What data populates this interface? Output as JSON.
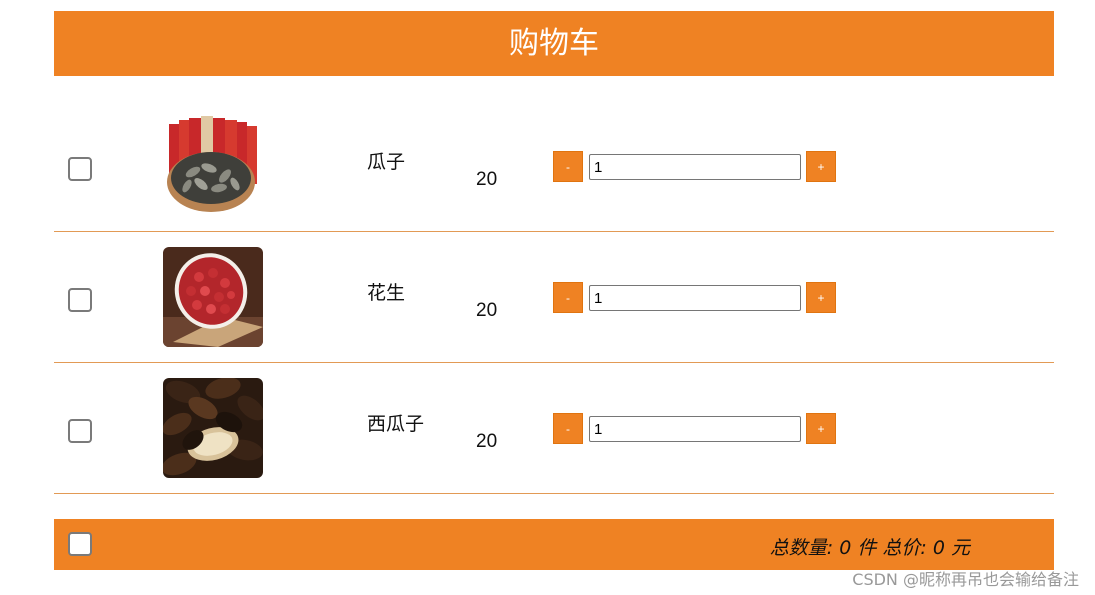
{
  "header": {
    "title": "购物车"
  },
  "items": [
    {
      "name": "瓜子",
      "price": "20",
      "quantity": "1",
      "minus_label": "-",
      "plus_label": "+",
      "image_icon": "sunflower-seeds-image"
    },
    {
      "name": "花生",
      "price": "20",
      "quantity": "1",
      "minus_label": "-",
      "plus_label": "+",
      "image_icon": "peanuts-image"
    },
    {
      "name": "西瓜子",
      "price": "20",
      "quantity": "1",
      "minus_label": "-",
      "plus_label": "+",
      "image_icon": "watermelon-seeds-image"
    }
  ],
  "footer": {
    "total_count_label": "总数量:",
    "total_count": "0",
    "count_unit": "件",
    "total_price_label": "总价:",
    "total_price": "0",
    "price_unit": "元"
  },
  "watermark": "CSDN @昵称再吊也会输给备注",
  "colors": {
    "accent": "#ef8223",
    "divider": "#e29a55"
  }
}
